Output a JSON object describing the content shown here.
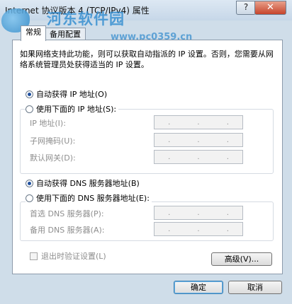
{
  "window": {
    "title": "Internet 协议版本 4 (TCP/IPv4) 属性",
    "help_label": "?",
    "close_label": "✕"
  },
  "watermark": {
    "site_name": "河东软件园",
    "url": "www.pc0359.cn"
  },
  "tabs": [
    {
      "label": "常规",
      "active": true
    },
    {
      "label": "备用配置",
      "active": false
    }
  ],
  "description": "如果网络支持此功能，则可以获取自动指派的 IP 设置。否则，您需要从网络系统管理员处获得适当的 IP 设置。",
  "ip_section": {
    "auto_label": "自动获得 IP 地址(O)",
    "manual_label": "使用下面的 IP 地址(S):",
    "auto_selected": true,
    "fields": [
      {
        "label": "IP 地址(I):"
      },
      {
        "label": "子网掩码(U):"
      },
      {
        "label": "默认网关(D):"
      }
    ]
  },
  "dns_section": {
    "auto_label": "自动获得 DNS 服务器地址(B)",
    "manual_label": "使用下面的 DNS 服务器地址(E):",
    "auto_selected": true,
    "fields": [
      {
        "label": "首选 DNS 服务器(P):"
      },
      {
        "label": "备用 DNS 服务器(A):"
      }
    ]
  },
  "validate_on_exit_label": "退出时验证设置(L)",
  "buttons": {
    "advanced": "高级(V)...",
    "ok": "确定",
    "cancel": "取消"
  },
  "colors": {
    "title_bar": "#cfdde9",
    "close_button": "#c6452d",
    "radio_dot": "#1f4f9e",
    "watermark": "#2e8bd0"
  }
}
